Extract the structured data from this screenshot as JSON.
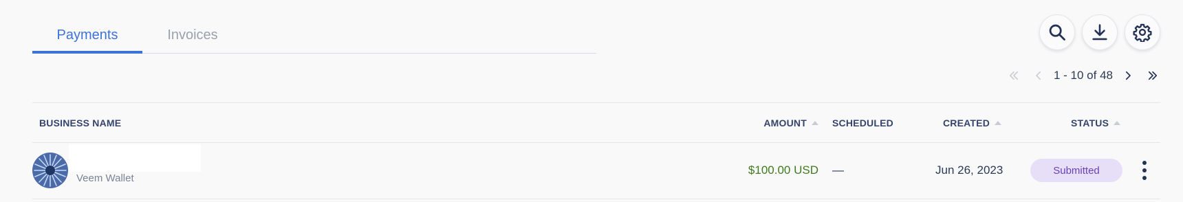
{
  "tabs": [
    {
      "label": "Payments",
      "active": true
    },
    {
      "label": "Invoices",
      "active": false
    }
  ],
  "toolbar": {
    "search_icon": "search-icon",
    "download_icon": "download-icon",
    "settings_icon": "gear-icon"
  },
  "pagination": {
    "range": "1 - 10 of 48"
  },
  "table": {
    "columns": {
      "business_name": "BUSINESS NAME",
      "amount": "AMOUNT",
      "scheduled": "SCHEDULED",
      "created": "CREATED",
      "status": "STATUS"
    },
    "rows": [
      {
        "business_name": "",
        "subtitle": "Veem Wallet",
        "amount": "$100.00 USD",
        "scheduled": "—",
        "created": "Jun 26, 2023",
        "status": "Submitted"
      }
    ]
  },
  "colors": {
    "accent": "#3b73d8",
    "amount_green": "#3f7a1e",
    "status_bg": "#e7def7",
    "status_text": "#6b3fb8"
  }
}
